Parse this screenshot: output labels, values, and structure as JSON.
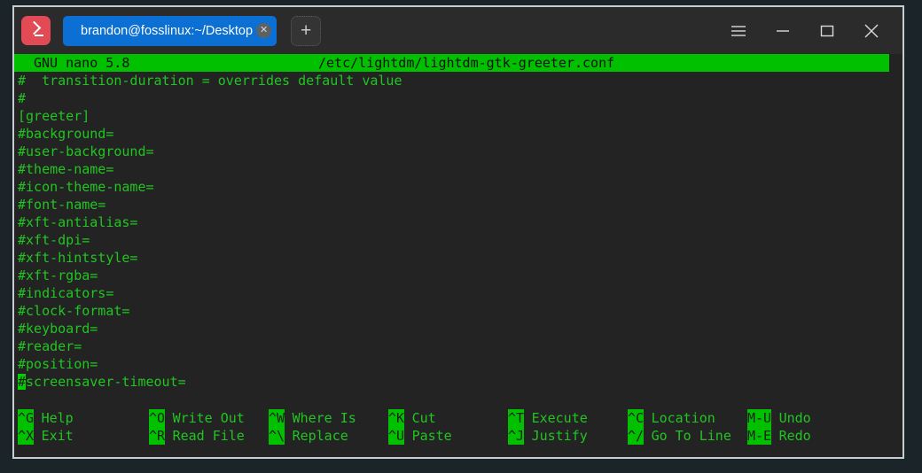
{
  "window": {
    "app_icon_name": "terminal-prompt-icon",
    "titlebar": {
      "menu_label": "☰",
      "minimize_label": "−",
      "maximize_label": "□",
      "close_label": "✕"
    },
    "tabs": [
      {
        "title": "brandon@fosslinux:~/Desktop",
        "close_label": "✕",
        "active": true
      }
    ],
    "new_tab_label": "+"
  },
  "nano": {
    "header": {
      "version": "GNU nano 5.8",
      "filename": "/etc/lightdm/lightdm-gtk-greeter.conf"
    },
    "lines": [
      "#  transition-duration = overrides default value",
      "#",
      "[greeter]",
      "#background=",
      "#user-background=",
      "#theme-name=",
      "#icon-theme-name=",
      "#font-name=",
      "#xft-antialias=",
      "#xft-dpi=",
      "#xft-hintstyle=",
      "#xft-rgba=",
      "#indicators=",
      "#clock-format=",
      "#keyboard=",
      "#reader=",
      "#position="
    ],
    "cursor_line": {
      "cursor_char": "#",
      "rest": "screensaver-timeout="
    },
    "shortcuts_row1": [
      {
        "key": "^G",
        "label": "Help"
      },
      {
        "key": "^O",
        "label": "Write Out"
      },
      {
        "key": "^W",
        "label": "Where Is"
      },
      {
        "key": "^K",
        "label": "Cut"
      },
      {
        "key": "^T",
        "label": "Execute"
      },
      {
        "key": "^C",
        "label": "Location"
      },
      {
        "key": "M-U",
        "label": "Undo"
      }
    ],
    "shortcuts_row2": [
      {
        "key": "^X",
        "label": "Exit"
      },
      {
        "key": "^R",
        "label": "Read File"
      },
      {
        "key": "^\\",
        "label": "Replace"
      },
      {
        "key": "^U",
        "label": "Paste"
      },
      {
        "key": "^J",
        "label": "Justify"
      },
      {
        "key": "^/",
        "label": "Go To Line"
      },
      {
        "key": "M-E",
        "label": "Redo"
      }
    ]
  },
  "colors": {
    "desktop_bg": "#1b2429",
    "titlebar_bg": "#2b2b2b",
    "terminal_bg": "#232323",
    "tab_active": "#0c6fd4",
    "nano_header_bg": "#00c000",
    "text_green": "#21c521",
    "cursor_green": "#00d000",
    "app_icon_red": "#e24b55"
  }
}
